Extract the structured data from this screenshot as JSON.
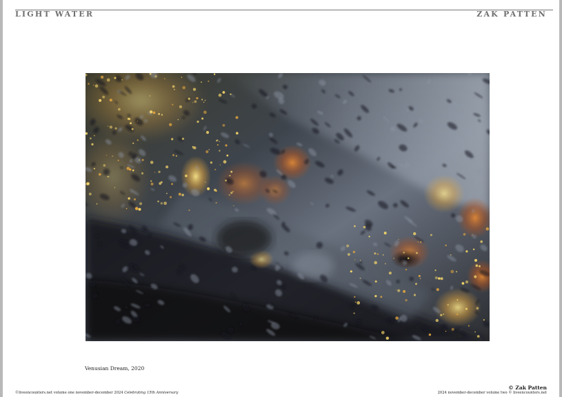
{
  "header": {
    "left_title": "LIGHT WATER",
    "right_title": "ZAK PATTEN"
  },
  "photo": {
    "caption": "Venusian Dream, 2020",
    "palette": {
      "shadow": "#17181b",
      "slate": "#6a7280",
      "sky": "#8d96a4",
      "amber": "#e1a540",
      "gold": "#f2d36a",
      "rust": "#b0521f"
    }
  },
  "credit": "© Zak Patten",
  "footer": {
    "left_plain": "©liveencounters.net volume one november-december 2024 ",
    "left_italic": "Celebrating 15th Anniversary",
    "right": "2024 november-december volume two © liveencounters.net"
  }
}
